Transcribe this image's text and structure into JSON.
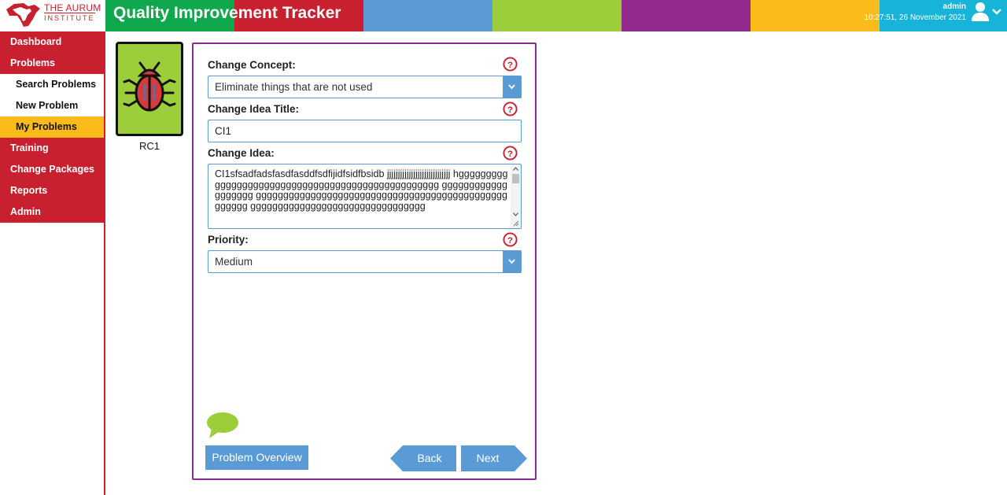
{
  "header": {
    "logo_line1": "THE AURUM",
    "logo_line2": "INSTITUTE",
    "app_title": "Quality Improvement Tracker",
    "user_name": "admin",
    "datetime": "10:27:51, 26 November 2021",
    "colors": [
      "#10a84d",
      "#c8202f",
      "#5b9bd5",
      "#9ccd3a",
      "#932a8e",
      "#fbbc1b",
      "#17b3d8"
    ]
  },
  "sidebar": {
    "items": [
      {
        "label": "Dashboard"
      },
      {
        "label": "Problems"
      },
      {
        "label": "Search Problems"
      },
      {
        "label": "New Problem"
      },
      {
        "label": "My Problems"
      },
      {
        "label": "Training"
      },
      {
        "label": "Change Packages"
      },
      {
        "label": "Reports"
      },
      {
        "label": "Admin"
      }
    ]
  },
  "card": {
    "label": "RC1",
    "icon": "bug-icon"
  },
  "form": {
    "change_concept": {
      "label": "Change Concept:",
      "value": "Eliminate things that are not used"
    },
    "change_idea_title": {
      "label": "Change Idea Title:",
      "value": "CI1"
    },
    "change_idea": {
      "label": "Change Idea:",
      "value": "CI1sfsadfadsfasdfasddfsdfijidfsidfbsidb jjjjjjjjjjjjjjjjjjjjjjjjjjjjj hgggggggggggggggggggggggggggggggggggggggggggggggggg ggggggggggggggggggg gggggggggggggggggggggggggggggggggggggggggggggggggggg gggggggggggggggggggggggggggggggg"
    },
    "priority": {
      "label": "Priority:",
      "value": "Medium"
    }
  },
  "buttons": {
    "overview": "Problem Overview",
    "back": "Back",
    "next": "Next"
  }
}
